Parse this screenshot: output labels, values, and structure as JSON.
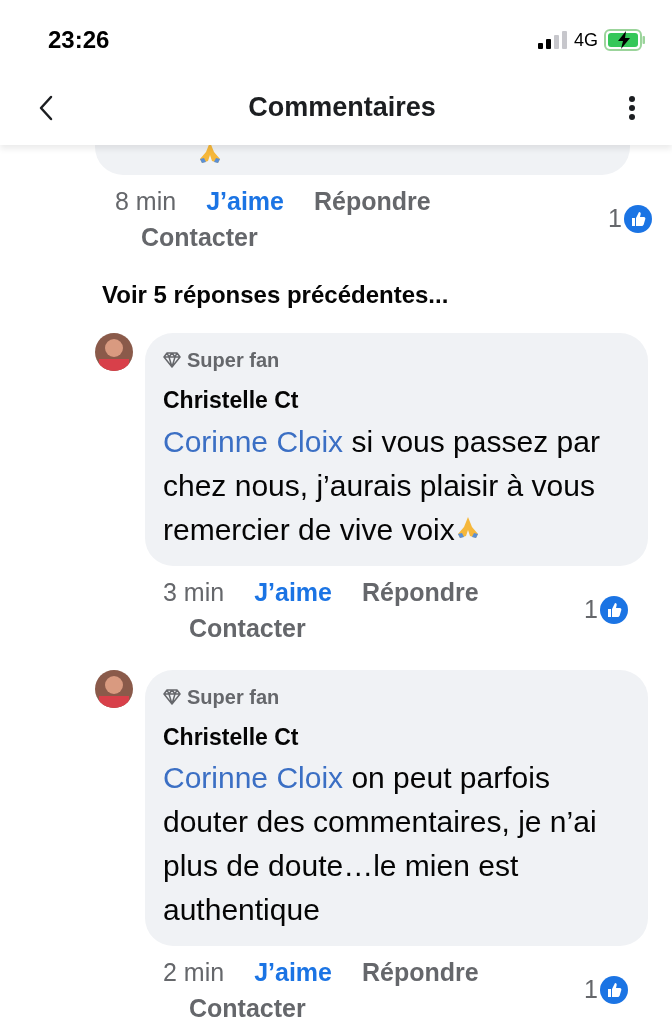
{
  "status_bar": {
    "time": "23:26",
    "network": "4G"
  },
  "header": {
    "title": "Commentaires"
  },
  "top_comment": {
    "pray_emoji": true,
    "time": "8 min",
    "like": "J’aime",
    "liked": true,
    "reply": "Répondre",
    "contact": "Contacter",
    "like_count": "1"
  },
  "more_replies": "Voir 5 réponses précédentes...",
  "replies": [
    {
      "badge": "Super fan",
      "author": "Christelle Ct",
      "mention": "Corinne Cloix",
      "text": " si vous passez par chez nous, j’aurais plaisir à vous remercier de vive voix",
      "pray_emoji": true,
      "time": "3 min",
      "like": "J’aime",
      "liked": true,
      "reply": "Répondre",
      "contact": "Contacter",
      "like_count": "1"
    },
    {
      "badge": "Super fan",
      "author": "Christelle Ct",
      "mention": "Corinne Cloix",
      "text": " on peut parfois douter des commentaires, je n’ai plus de doute…le mien est authentique",
      "time": "2 min",
      "like": "J’aime",
      "liked": true,
      "reply": "Répondre",
      "contact": "Contacter",
      "like_count": "1"
    }
  ]
}
